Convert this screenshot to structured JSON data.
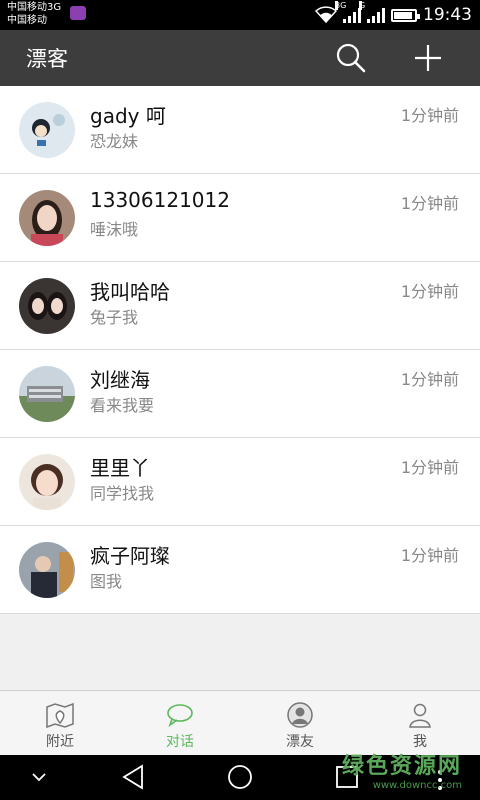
{
  "status_bar": {
    "carrier1": "中国移动3G",
    "carrier2": "中国移动",
    "sig1_tag": "3G",
    "sig2_tag": "G",
    "time": "19:43"
  },
  "app_bar": {
    "title": "漂客"
  },
  "conversations": [
    {
      "name": "gady 呵",
      "message": "恐龙妹",
      "time": "1分钟前",
      "avatar": "avatar-1"
    },
    {
      "name": "13306121012",
      "message": "唾沫哦",
      "time": "1分钟前",
      "avatar": "avatar-2"
    },
    {
      "name": "我叫哈哈",
      "message": "兔子我",
      "time": "1分钟前",
      "avatar": "avatar-3"
    },
    {
      "name": "刘继海",
      "message": "看来我要",
      "time": "1分钟前",
      "avatar": "avatar-4"
    },
    {
      "name": "里里丫",
      "message": "同学找我",
      "time": "1分钟前",
      "avatar": "avatar-5"
    },
    {
      "name": "疯子阿璨",
      "message": "图我",
      "time": "1分钟前",
      "avatar": "avatar-6"
    }
  ],
  "tabs": [
    {
      "label": "附近",
      "icon": "map-pin-icon"
    },
    {
      "label": "对话",
      "icon": "chat-bubble-icon",
      "active": true
    },
    {
      "label": "漂友",
      "icon": "friend-avatar-icon"
    },
    {
      "label": "我",
      "icon": "person-icon"
    }
  ],
  "watermark": {
    "title": "绿色资源网",
    "url": "www.downcc.com"
  },
  "colors": {
    "app_bar": "#3d3d3d",
    "active_tab": "#5db85d"
  }
}
